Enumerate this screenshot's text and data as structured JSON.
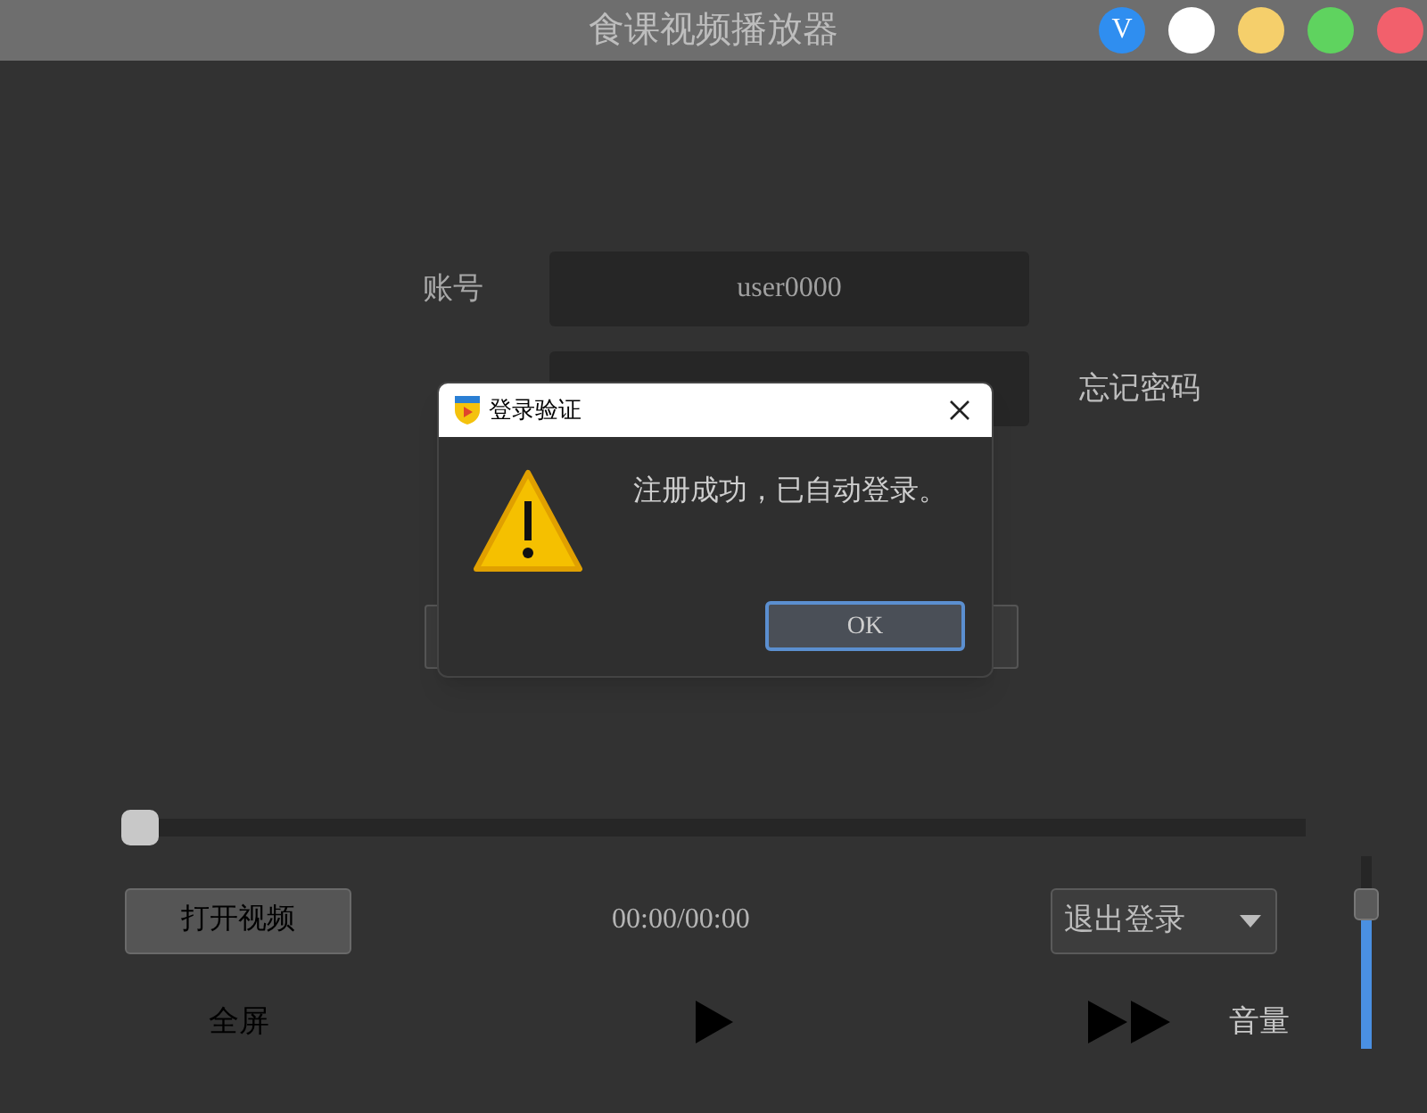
{
  "window": {
    "title": "食课视频播放器",
    "badge": "V",
    "dots": [
      {
        "color": "#ffffff"
      },
      {
        "color": "#f5cf6b"
      },
      {
        "color": "#5fd35f"
      },
      {
        "color": "#f2606c"
      }
    ]
  },
  "login": {
    "account_label": "账号",
    "account_value": "user0000",
    "forgot_password": "忘记密码"
  },
  "dialog": {
    "title": "登录验证",
    "message": "注册成功，已自动登录。",
    "ok": "OK"
  },
  "player": {
    "progress": {
      "level": 0
    },
    "open_button": "打开视频",
    "time": "00:00/00:00",
    "account_menu": {
      "value": "退出登录"
    },
    "fullscreen": "全屏",
    "volume_label": "音量",
    "volume": {
      "level": 0.75
    }
  }
}
